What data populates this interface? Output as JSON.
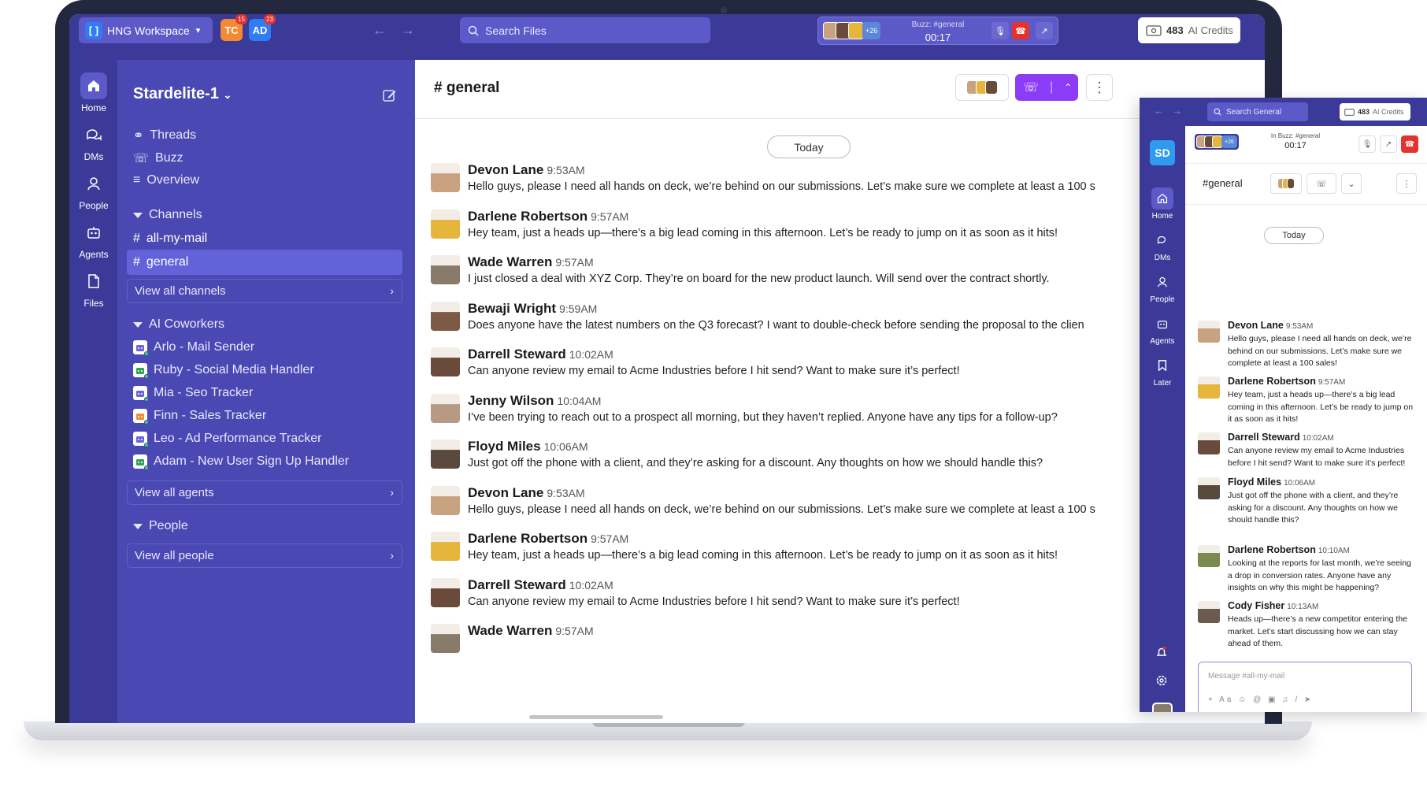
{
  "topbar": {
    "workspace": "HNG Workspace",
    "tabs": [
      {
        "initials": "TC",
        "badge": "15",
        "color": "#f28b34"
      },
      {
        "initials": "AD",
        "badge": "23",
        "color": "#2f7cf6"
      }
    ],
    "search_placeholder": "Search Files",
    "call": {
      "title": "Buzz: #general",
      "time": "00:17",
      "more": "+26"
    },
    "credits_value": "483",
    "credits_label": "AI Credits"
  },
  "rail": {
    "items": [
      "Home",
      "DMs",
      "People",
      "Agents",
      "Files"
    ]
  },
  "sidebar": {
    "workspace_title": "Stardelite-1",
    "nav": [
      "Threads",
      "Buzz",
      "Overview"
    ],
    "channels_header": "Channels",
    "channels": [
      "all-my-mail",
      "general"
    ],
    "view_all_channels": "View all channels",
    "ai_header": "AI Coworkers",
    "agents": [
      {
        "name": "Arlo - Mail Sender",
        "color": "#6b64d9"
      },
      {
        "name": "Ruby - Social Media Handler",
        "color": "#2fa35a"
      },
      {
        "name": "Mia - Seo Tracker",
        "color": "#6b64d9"
      },
      {
        "name": "Finn - Sales Tracker",
        "color": "#f28b34"
      },
      {
        "name": "Leo - Ad Performance Tracker",
        "color": "#6b64d9"
      },
      {
        "name": "Adam - New User Sign Up Handler",
        "color": "#2fa35a"
      }
    ],
    "view_all_agents": "View all agents",
    "people_header": "People",
    "view_all_people": "View all people"
  },
  "main": {
    "channel_title": "# general",
    "today": "Today",
    "messages": [
      {
        "name": "Devon Lane",
        "time": "9:53AM",
        "text": "Hello guys, please I need all hands on deck, we’re behind on our submissions. Let’s  make sure we complete at least a 100 s",
        "color": "#c9a27f"
      },
      {
        "name": "Darlene Robertson",
        "time": "9:57AM",
        "text": "Hey team, just a heads up—there’s a big lead coming in this afternoon. Let’s be ready to jump on it as soon as it hits!",
        "color": "#e6b53b"
      },
      {
        "name": "Wade Warren",
        "time": "9:57AM",
        "text": "I just closed a deal with XYZ Corp. They’re on board for the new product launch. Will send over the contract shortly.",
        "color": "#8a7a6a"
      },
      {
        "name": "Bewaji Wright",
        "time": "9:59AM",
        "text": "Does anyone have the latest numbers on the Q3 forecast? I want to double-check before sending the proposal to the clien",
        "color": "#7d5a46"
      },
      {
        "name": "Darrell Steward",
        "time": "10:02AM",
        "text": "Can anyone review my email to Acme Industries before I hit send? Want to make sure it’s perfect!",
        "color": "#6a4a3a"
      },
      {
        "name": "Jenny Wilson",
        "time": "10:04AM",
        "text": "I’ve been trying to reach out to a prospect all morning, but they haven’t replied. Anyone have any tips for a follow-up?",
        "color": "#b89a84"
      },
      {
        "name": "Floyd Miles",
        "time": "10:06AM",
        "text": "Just got off the phone with a client, and they’re asking for a discount. Any thoughts on how we should handle this?",
        "color": "#5a4a3e"
      },
      {
        "name": "Devon Lane",
        "time": "9:53AM",
        "text": "Hello guys, please I need all hands on deck, we’re behind on our submissions. Let’s  make sure we complete at least a 100 s",
        "color": "#c9a27f"
      },
      {
        "name": "Darlene Robertson",
        "time": "9:57AM",
        "text": "Hey team, just a heads up—there’s a big lead coming in this afternoon. Let’s be ready to jump on it as soon as it hits!",
        "color": "#e6b53b"
      },
      {
        "name": "Darrell Steward",
        "time": "10:02AM",
        "text": "Can anyone review my email to Acme Industries before I hit send? Want to make sure it’s perfect!",
        "color": "#6a4a3a"
      },
      {
        "name": "Wade Warren",
        "time": "9:57AM",
        "text": "",
        "color": "#8a7a6a"
      }
    ]
  },
  "window": {
    "search_placeholder": "Search General",
    "credits_value": "483",
    "credits_label": "AI Credits",
    "workspace_initials": "SD",
    "rail": [
      "Home",
      "DMs",
      "People",
      "Agents",
      "Later"
    ],
    "call": {
      "title": "In Buzz: #general",
      "time": "00:17",
      "more": "+26"
    },
    "channel_title": "#general",
    "today": "Today",
    "messages": [
      {
        "name": "Devon Lane",
        "time": "9:53AM",
        "text": "Hello guys, please I need all hands on deck, we’re behind on our submissions. Let’s  make sure we complete at least a 100 sales!",
        "color": "#c9a27f"
      },
      {
        "name": "Darlene Robertson",
        "time": "9:57AM",
        "text": "Hey team, just a heads up—there’s a big lead coming in this afternoon. Let’s be ready to jump on it as soon as it hits!",
        "color": "#e6b53b"
      },
      {
        "name": "Darrell Steward",
        "time": "10:02AM",
        "text": "Can anyone review my email to Acme Industries before I hit send? Want to make sure it’s perfect!",
        "color": "#6a4a3a"
      },
      {
        "name": "Floyd Miles",
        "time": "10:06AM",
        "text": "Just got off the phone with a client, and they’re asking for a discount. Any thoughts on how we should handle this?",
        "color": "#5a4a3e"
      },
      {
        "name": "Darlene Robertson",
        "time": "10:10AM",
        "text": "Looking at the reports for last month, we’re seeing a drop in conversion rates. Anyone have any insights on why this might be happening?",
        "color": "#7b8a4f"
      },
      {
        "name": "Cody Fisher",
        "time": "10:13AM",
        "text": "Heads up—there’s a new competitor entering the market. Let’s start discussing how we can stay ahead of them.",
        "color": "#6b5a50"
      }
    ],
    "composer_placeholder": "Message #all-my-mail"
  }
}
